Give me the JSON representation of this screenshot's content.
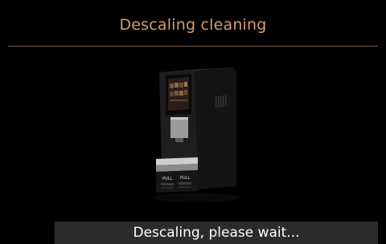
{
  "header": {
    "title": "Descaling cleaning"
  },
  "machine": {
    "icon": "coffee-machine-image",
    "tray_labels": [
      "PULL",
      "PULL"
    ]
  },
  "status": {
    "message": "Descaling, please wait..."
  },
  "colors": {
    "background": "#000000",
    "title": "#d49a72",
    "divider": "#7a5a45",
    "status_bar": "#2b2b2b",
    "status_text": "#ffffff"
  }
}
